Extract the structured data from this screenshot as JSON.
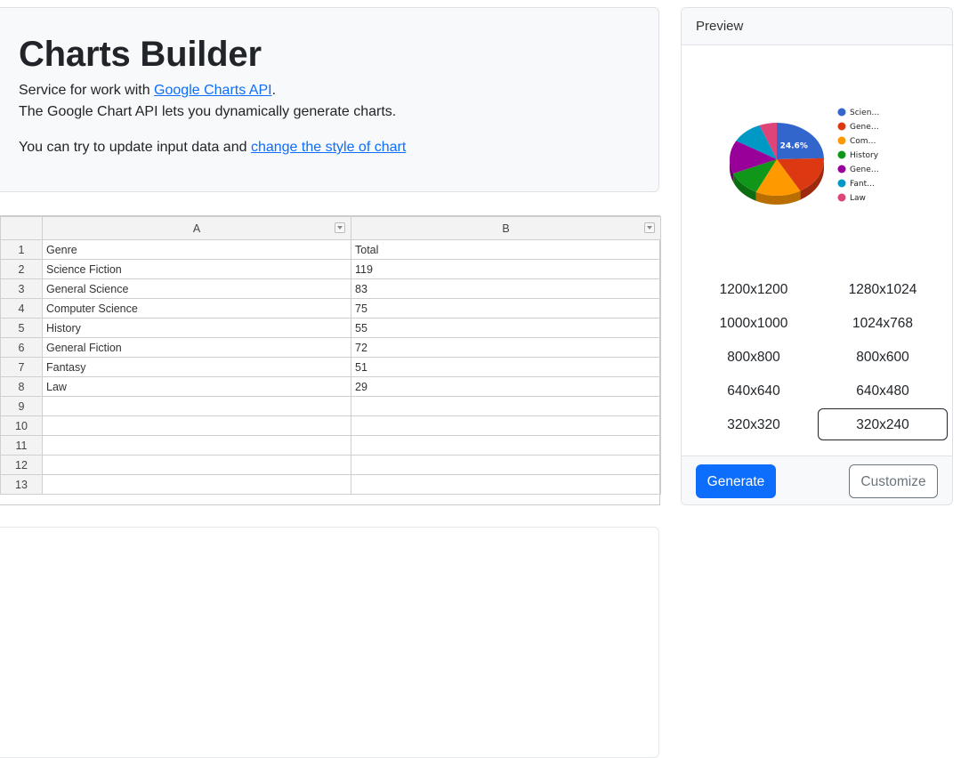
{
  "hero": {
    "title": "Charts Builder",
    "line1_prefix": "Service for work with ",
    "line1_link": "Google Charts API",
    "line1_suffix": ".",
    "line2": "The Google Chart API lets you dynamically generate charts.",
    "line3_prefix": "You can try to update input data and ",
    "line3_link": "change the style of chart"
  },
  "sheet": {
    "columns": [
      "A",
      "B"
    ],
    "rows": [
      [
        "1",
        "Genre",
        "Total"
      ],
      [
        "2",
        "Science Fiction",
        "119"
      ],
      [
        "3",
        "General Science",
        "83"
      ],
      [
        "4",
        "Computer Science",
        "75"
      ],
      [
        "5",
        "History",
        "55"
      ],
      [
        "6",
        "General Fiction",
        "72"
      ],
      [
        "7",
        "Fantasy",
        "51"
      ],
      [
        "8",
        "Law",
        "29"
      ],
      [
        "9",
        "",
        ""
      ],
      [
        "10",
        "",
        ""
      ],
      [
        "11",
        "",
        ""
      ],
      [
        "12",
        "",
        ""
      ],
      [
        "13",
        "",
        ""
      ]
    ]
  },
  "preview": {
    "header": "Preview",
    "sizes": [
      "1200x1200",
      "1280x1024",
      "1000x1000",
      "1024x768",
      "800x800",
      "800x600",
      "640x640",
      "640x480",
      "320x320",
      "320x240"
    ],
    "selected_size": "320x240",
    "generate_label": "Generate",
    "customize_label": "Customize"
  },
  "chart_data": {
    "type": "pie",
    "style": "3d",
    "categories": [
      "Science Fiction",
      "General Science",
      "Computer Science",
      "History",
      "General Fiction",
      "Fantasy",
      "Law"
    ],
    "values": [
      119,
      83,
      75,
      55,
      72,
      51,
      29
    ],
    "legend_labels": [
      "Scien…",
      "Gene…",
      "Com…",
      "History",
      "Gene…",
      "Fant…",
      "Law"
    ],
    "slice_label": "24.6%",
    "colors": [
      "#3366cc",
      "#dc3912",
      "#ff9900",
      "#109618",
      "#990099",
      "#0099c6",
      "#dd4477"
    ],
    "legend_position": "right"
  },
  "colors": {
    "primary": "#0d6efd",
    "secondary": "#6c757d"
  }
}
